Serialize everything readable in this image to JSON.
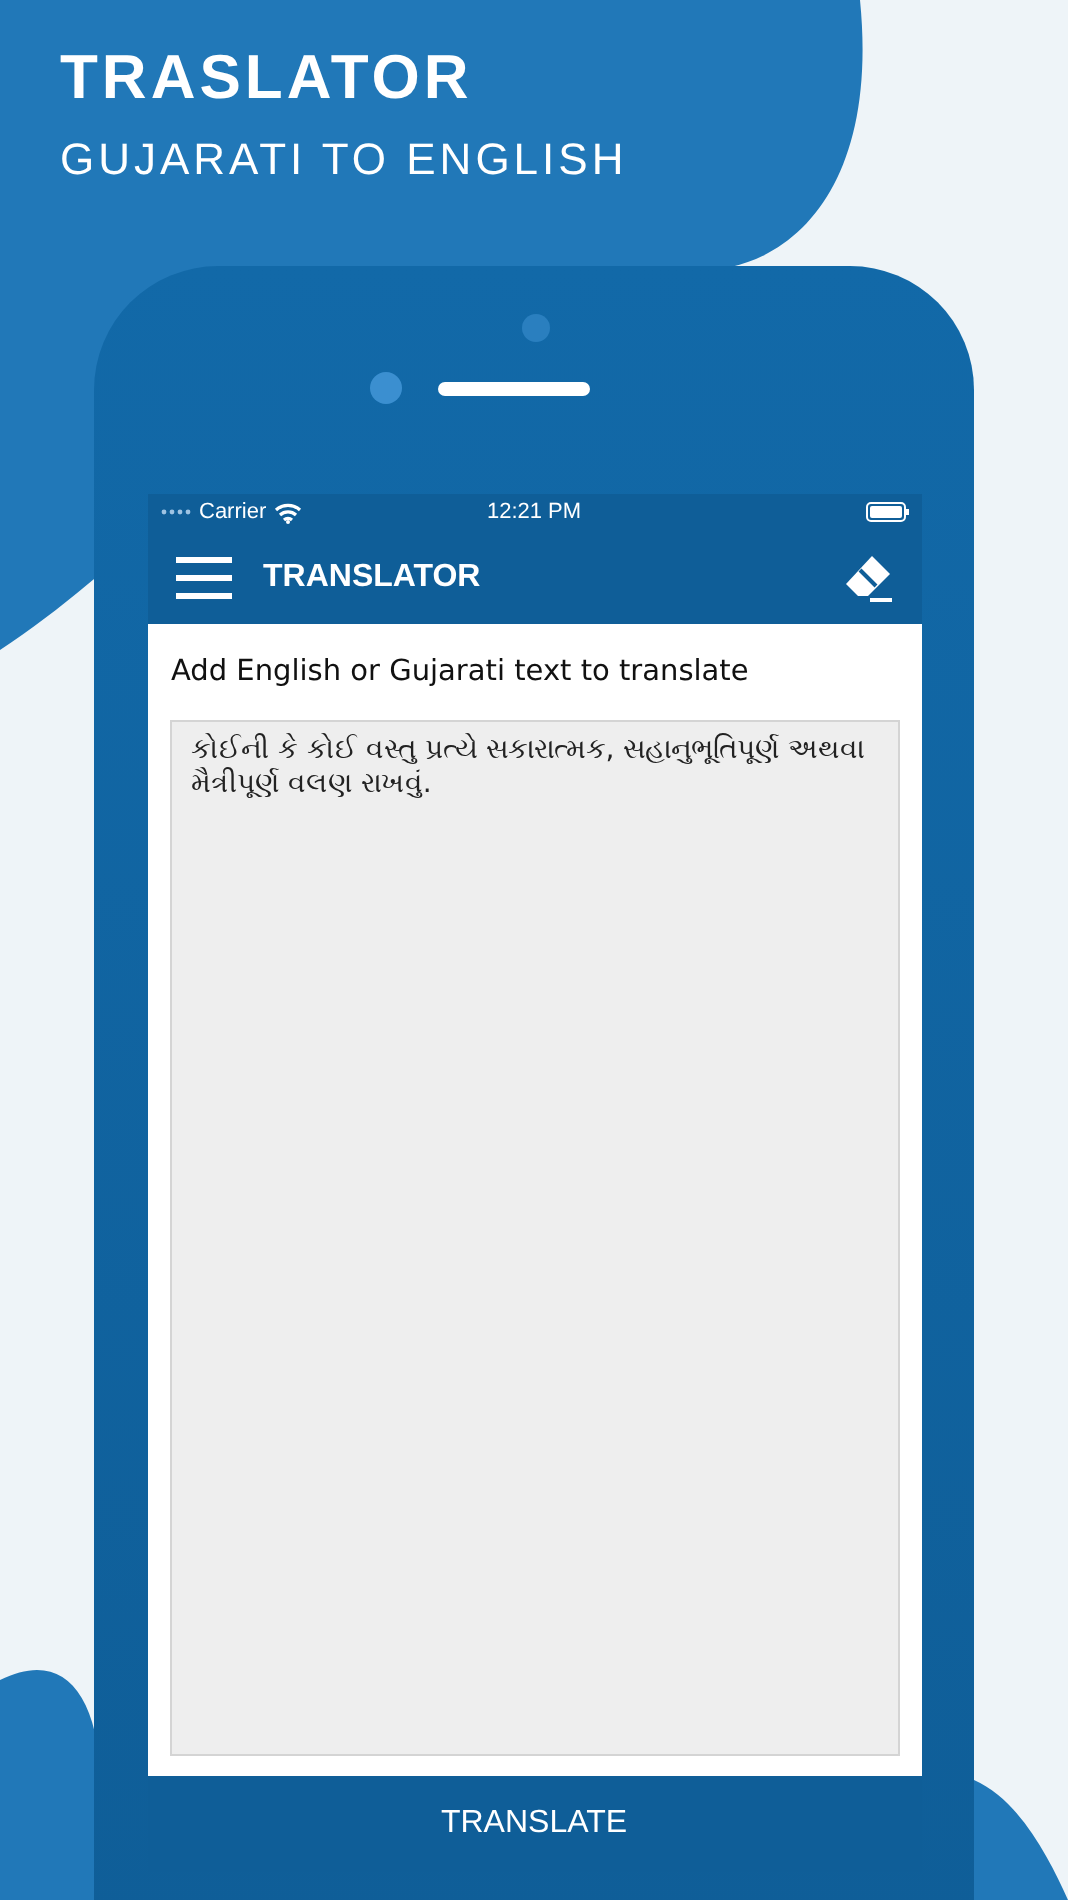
{
  "header": {
    "title": "TRASLATOR",
    "subtitle": "GUJARATI TO ENGLISH"
  },
  "status_bar": {
    "carrier": "Carrier",
    "time": "12:21 PM"
  },
  "nav_bar": {
    "title": "TRANSLATOR"
  },
  "prompt": "Add English or Gujarati text to translate",
  "text_input": {
    "value": "કોઈની કે કોઈ વસ્તુ પ્રત્યે સકારાત્મક, સહાનુભૂતિપૂર્ણ અથવા મૈત્રીપૂર્ણ વલણ રાખવું."
  },
  "translate_button": "TRANSLATE"
}
